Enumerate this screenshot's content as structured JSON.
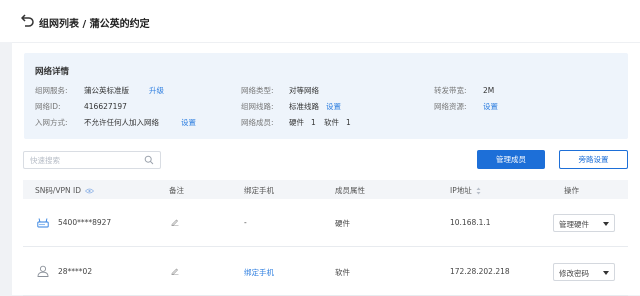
{
  "header": {
    "title": "组网列表 / 蒲公英的约定"
  },
  "info": {
    "title": "网络详情",
    "service_label": "组网服务:",
    "service_value": "蒲公英标准版",
    "upgrade_link": "升级",
    "id_label": "网络ID:",
    "id_value": "416627197",
    "join_label": "入网方式:",
    "join_value": "不允许任何人加入网络",
    "join_link": "设置",
    "type_label": "网络类型:",
    "type_value": "对等网络",
    "line_label": "组网线路:",
    "line_value": "标准线路",
    "line_link": "设置",
    "members_label": "网络成员:",
    "members_hw": "硬件",
    "members_hw_count": "1",
    "members_sw": "软件",
    "members_sw_count": "1",
    "bandwidth_label": "转发带宽:",
    "bandwidth_value": "2M",
    "resource_label": "网络资源:",
    "resource_link": "设置"
  },
  "toolbar": {
    "search_placeholder": "快速搜索",
    "manage_members": "管理成员",
    "bypass_settings": "旁路设置"
  },
  "table": {
    "columns": [
      "SN码/VPN ID",
      "备注",
      "绑定手机",
      "成员属性",
      "IP地址",
      "操作"
    ],
    "rows": [
      {
        "id": "5400****8927",
        "phone": "-",
        "attr": "硬件",
        "ip": "10.168.1.1",
        "action": "管理硬件",
        "phone_is_link": false
      },
      {
        "id": "28****02",
        "phone": "绑定手机",
        "attr": "软件",
        "ip": "172.28.202.218",
        "action": "修改密码",
        "phone_is_link": true
      }
    ]
  },
  "colors": {
    "primary": "#1d6fd8",
    "link": "#2f7fe0",
    "info_bg": "#eef4fb"
  },
  "icons": {
    "back": "back-arrow-icon",
    "search": "search-icon",
    "eye": "eye-icon",
    "sort": "sort-icon",
    "edit": "pencil-icon",
    "router": "router-icon",
    "user": "user-icon"
  }
}
